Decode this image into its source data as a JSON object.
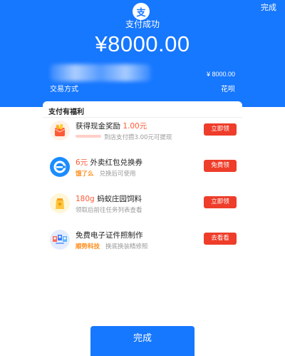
{
  "header": {
    "done_link": "完成",
    "logo_glyph": "支",
    "status_title": "支付成功",
    "amount": "¥8000.00",
    "row_amount": "¥ 8000.00",
    "trade_label": "交易方式",
    "trade_value": "花呗"
  },
  "benefits": {
    "title": "支付有福利",
    "items": [
      {
        "title_main": "获得现金奖励",
        "title_accent": "1.00元",
        "brand": "",
        "subtitle": "到店支付攒3.00元可提现",
        "button": "立即领",
        "icon": "red-envelope-cash-icon"
      },
      {
        "title_accent": "6元",
        "title_main": "外卖红包兑换券",
        "brand": "饿了么",
        "subtitle": "兑换后可使用",
        "button": "免费领",
        "icon": "eleme-icon"
      },
      {
        "title_accent": "180g",
        "title_main": "蚂蚁庄园饲料",
        "brand": "",
        "subtitle": "领取后前往任务列表查看",
        "button": "立即领",
        "icon": "feed-bag-icon"
      },
      {
        "title_main": "免费电子证件照制作",
        "brand": "顺势科技",
        "subtitle": "换底换装精修照",
        "button": "去看看",
        "icon": "id-photo-icon"
      }
    ]
  },
  "footer": {
    "done_button": "完成"
  },
  "colors": {
    "primary_blue": "#1677ff",
    "button_red": "#ee3d2a",
    "accent_red": "#ff5a36",
    "brand_orange": "#ff8c1a"
  }
}
